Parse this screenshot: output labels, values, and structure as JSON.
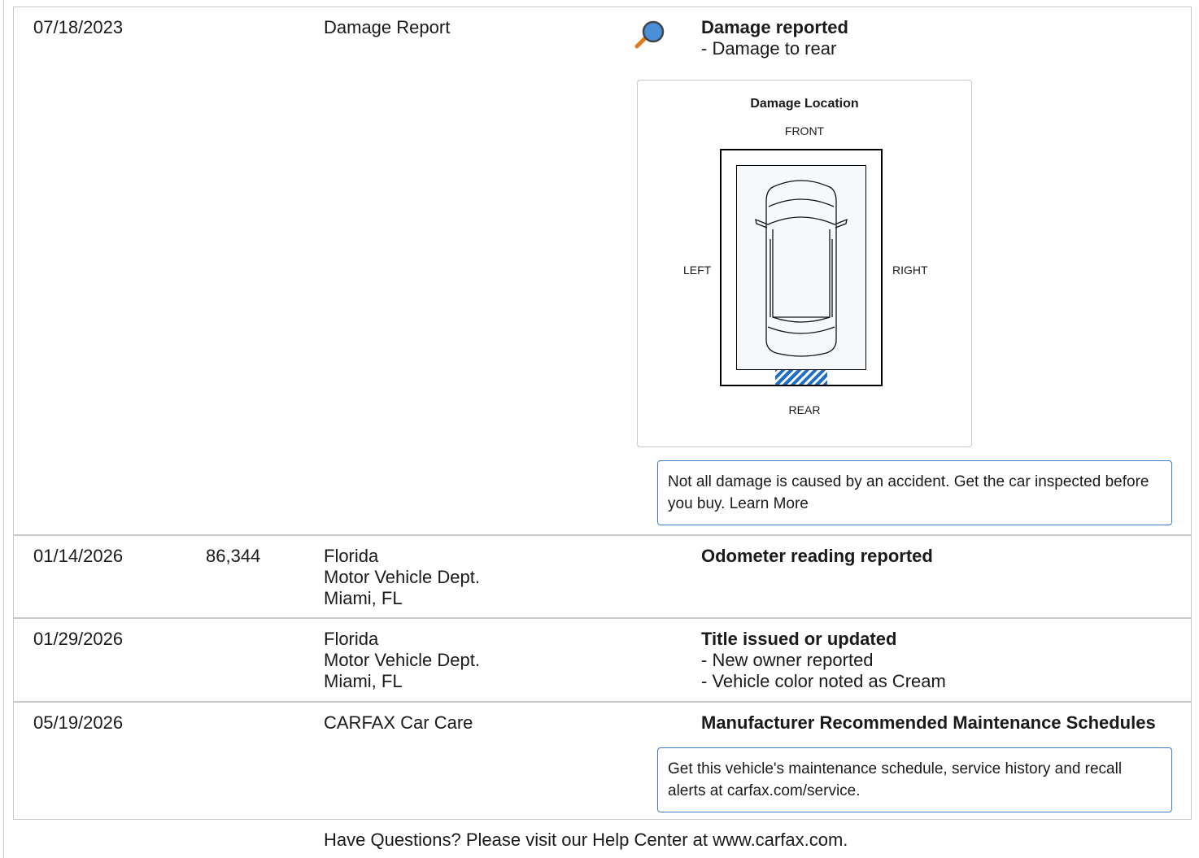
{
  "records": [
    {
      "date": "07/18/2023",
      "odometer": "",
      "source": "Damage Report",
      "title": "Damage reported",
      "details": [
        "- Damage to rear"
      ],
      "damage_diagram": {
        "title": "Damage Location",
        "front": "FRONT",
        "rear": "REAR",
        "left": "LEFT",
        "right": "RIGHT",
        "damaged_zone": "rear"
      },
      "note": "Not all damage is caused by an accident. Get the car inspected before you buy. Learn More",
      "icon": "magnifier-icon"
    },
    {
      "date": "01/14/2026",
      "odometer": "86,344",
      "source": "Florida\nMotor Vehicle Dept.\nMiami, FL",
      "title": "Odometer reading reported",
      "details": []
    },
    {
      "date": "01/29/2026",
      "odometer": "",
      "source": "Florida\nMotor Vehicle Dept.\nMiami, FL",
      "title": "Title issued or updated",
      "details": [
        "- New owner reported",
        "- Vehicle color noted as Cream"
      ]
    },
    {
      "date": "05/19/2026",
      "odometer": "",
      "source": "CARFAX Car Care",
      "title": "Manufacturer Recommended Maintenance Schedules",
      "details": [],
      "note": "Get this vehicle's maintenance schedule, service history and recall alerts at carfax.com/service."
    }
  ],
  "footer": "Have Questions? Please visit our Help Center at www.carfax.com.",
  "colors": {
    "accent": "#3a7fc6",
    "hatch": "#1e6fc8",
    "magnifier_lens": "#4a90d9",
    "magnifier_handle": "#e07a1f"
  }
}
